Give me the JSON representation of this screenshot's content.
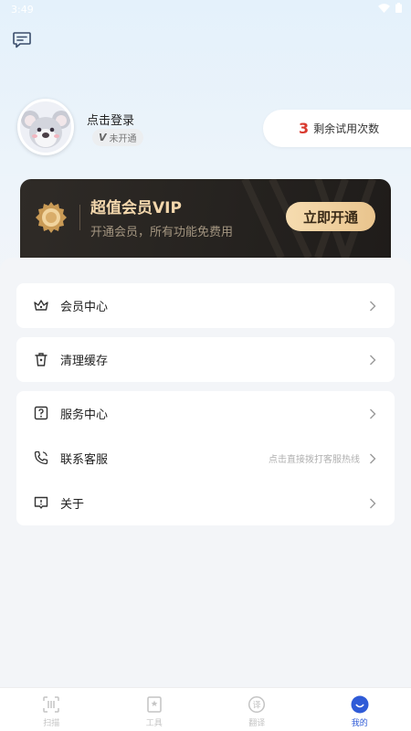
{
  "status_bar": {
    "time": "3:49"
  },
  "profile": {
    "login_text": "点击登录",
    "member_status": "未开通",
    "member_badge_letter": "V"
  },
  "trial": {
    "count": "3",
    "label": "剩余试用次数"
  },
  "vip": {
    "title": "超值会员VIP",
    "subtitle": "开通会员，所有功能免费用",
    "button": "立即开通"
  },
  "menu": {
    "member_center": "会员中心",
    "clear_cache": "清理缓存",
    "service_center": "服务中心",
    "contact_service": "联系客服",
    "contact_hint": "点击直接拨打客服热线",
    "about": "关于"
  },
  "bottom_nav": {
    "scan": "扫描",
    "tools": "工具",
    "translate": "翻译",
    "mine": "我的"
  },
  "colors": {
    "accent": "#2f5bd7",
    "trial_count": "#d93a2f",
    "vip_gold": "#f3d7ac"
  }
}
